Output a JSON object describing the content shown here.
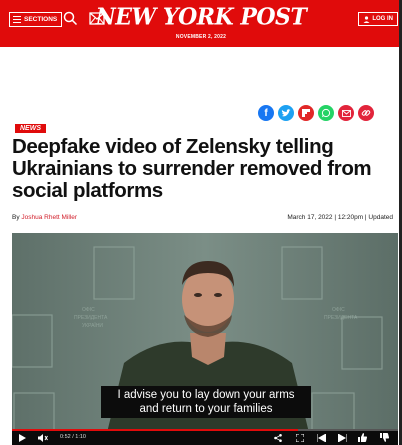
{
  "header": {
    "sections_label": "SECTIONS",
    "logo_text": "NEW YORK POST",
    "date": "NOVEMBER 2, 2022",
    "login_label": "LOG IN"
  },
  "article": {
    "tag": "NEWS",
    "headline": "Deepfake video of Zelensky telling Ukrainians to surrender removed from social platforms",
    "byline_prefix": "By ",
    "author": "Joshua Rhett Miller",
    "dateline": "March 17, 2022 | 12:20pm | Updated"
  },
  "share_icons": [
    "facebook-icon",
    "twitter-icon",
    "flipboard-icon",
    "whatsapp-icon",
    "email-icon",
    "link-icon"
  ],
  "video": {
    "caption_line1": "I advise you to lay down your arms",
    "caption_line2": "and return to your families",
    "time": "0:52 / 1:10",
    "progress": 0.74
  },
  "colors": {
    "brand_red": "#e00b0b"
  }
}
